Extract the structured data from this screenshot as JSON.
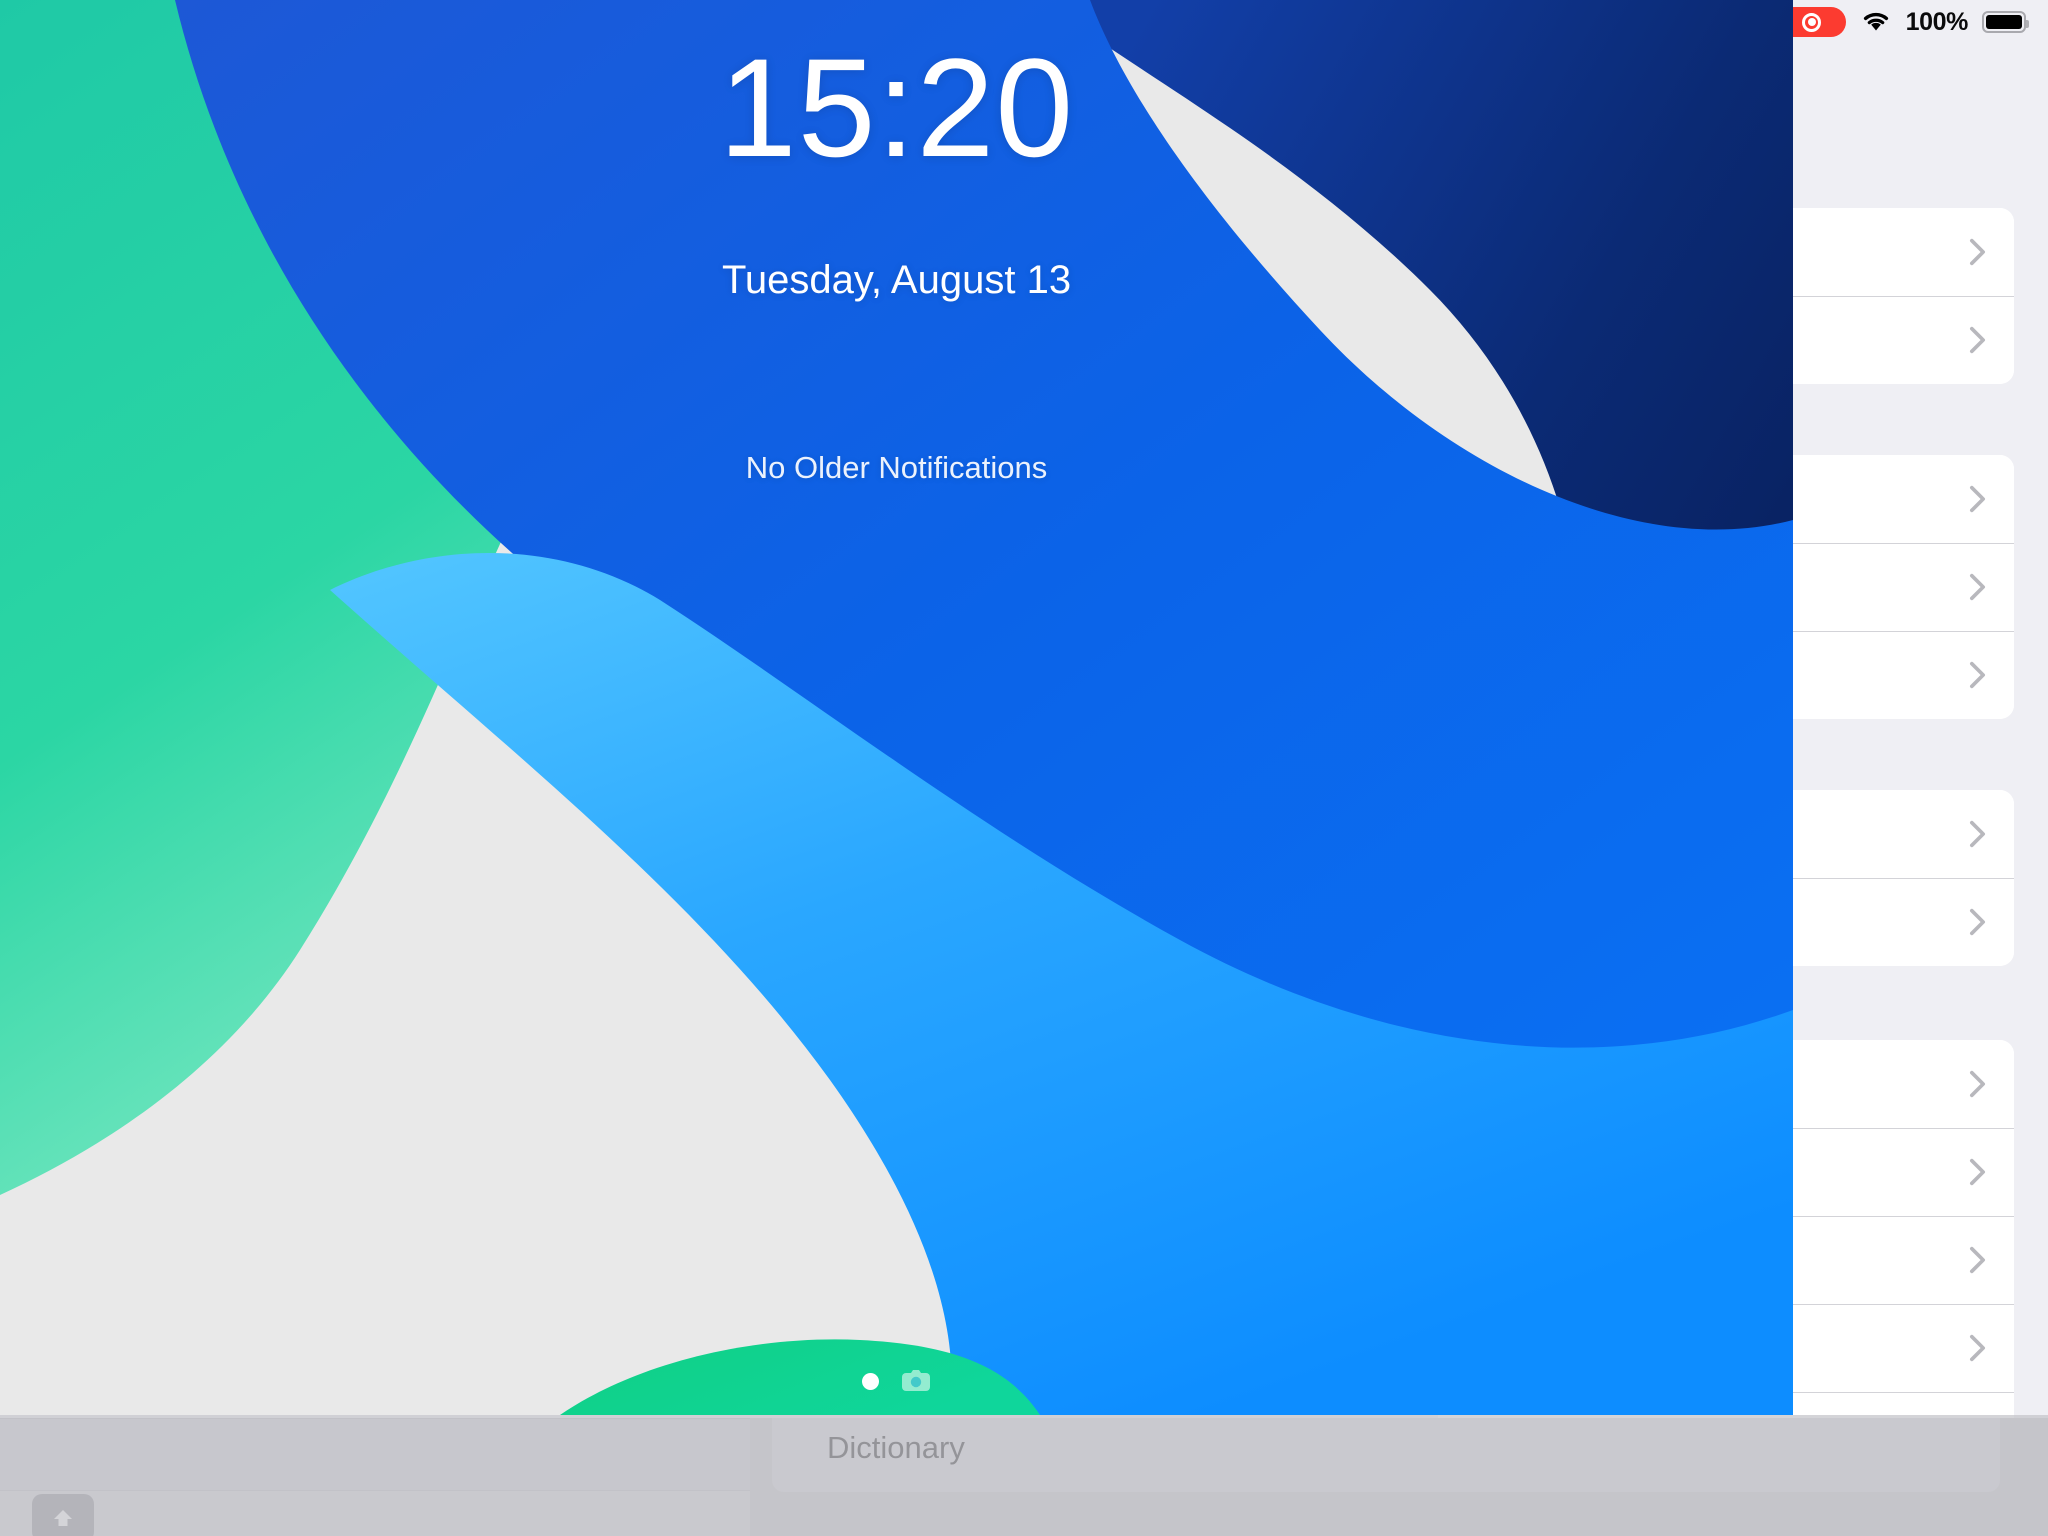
{
  "status_bar": {
    "screen_recording_indicator": "screen-recording-active",
    "wifi": "wifi-icon",
    "battery_percent": "100%",
    "battery": "battery-full-icon"
  },
  "lock_screen": {
    "time": "15:20",
    "date": "Tuesday, August 13",
    "notifications_text": "No Older Notifications",
    "page_indicator": "page-dot",
    "camera_shortcut": "camera-icon"
  },
  "settings": {
    "groups": [
      {
        "rows": [
          {
            "label": ""
          },
          {
            "label": ""
          }
        ]
      },
      {
        "rows": [
          {
            "label": ""
          },
          {
            "label": ""
          },
          {
            "label": ""
          }
        ]
      },
      {
        "rows": [
          {
            "label": ""
          },
          {
            "label": ""
          }
        ]
      },
      {
        "rows": [
          {
            "label": ""
          },
          {
            "label": ""
          },
          {
            "label": ""
          },
          {
            "label": ""
          },
          {
            "label": ""
          }
        ]
      }
    ],
    "chevron": "chevron-right-icon"
  },
  "keyboard": {
    "shift_key": "shift-icon"
  },
  "dictionary_bar": {
    "label": "Dictionary"
  },
  "colors": {
    "accent_blue": "#0a66d8",
    "deep_navy": "#0d2b6b",
    "teal": "#22c79e",
    "sky": "#31b4ff",
    "recording_red": "#fc3b30",
    "settings_bg": "#efeff4",
    "row_bg": "#ffffff",
    "separator": "#d3d3d8"
  }
}
